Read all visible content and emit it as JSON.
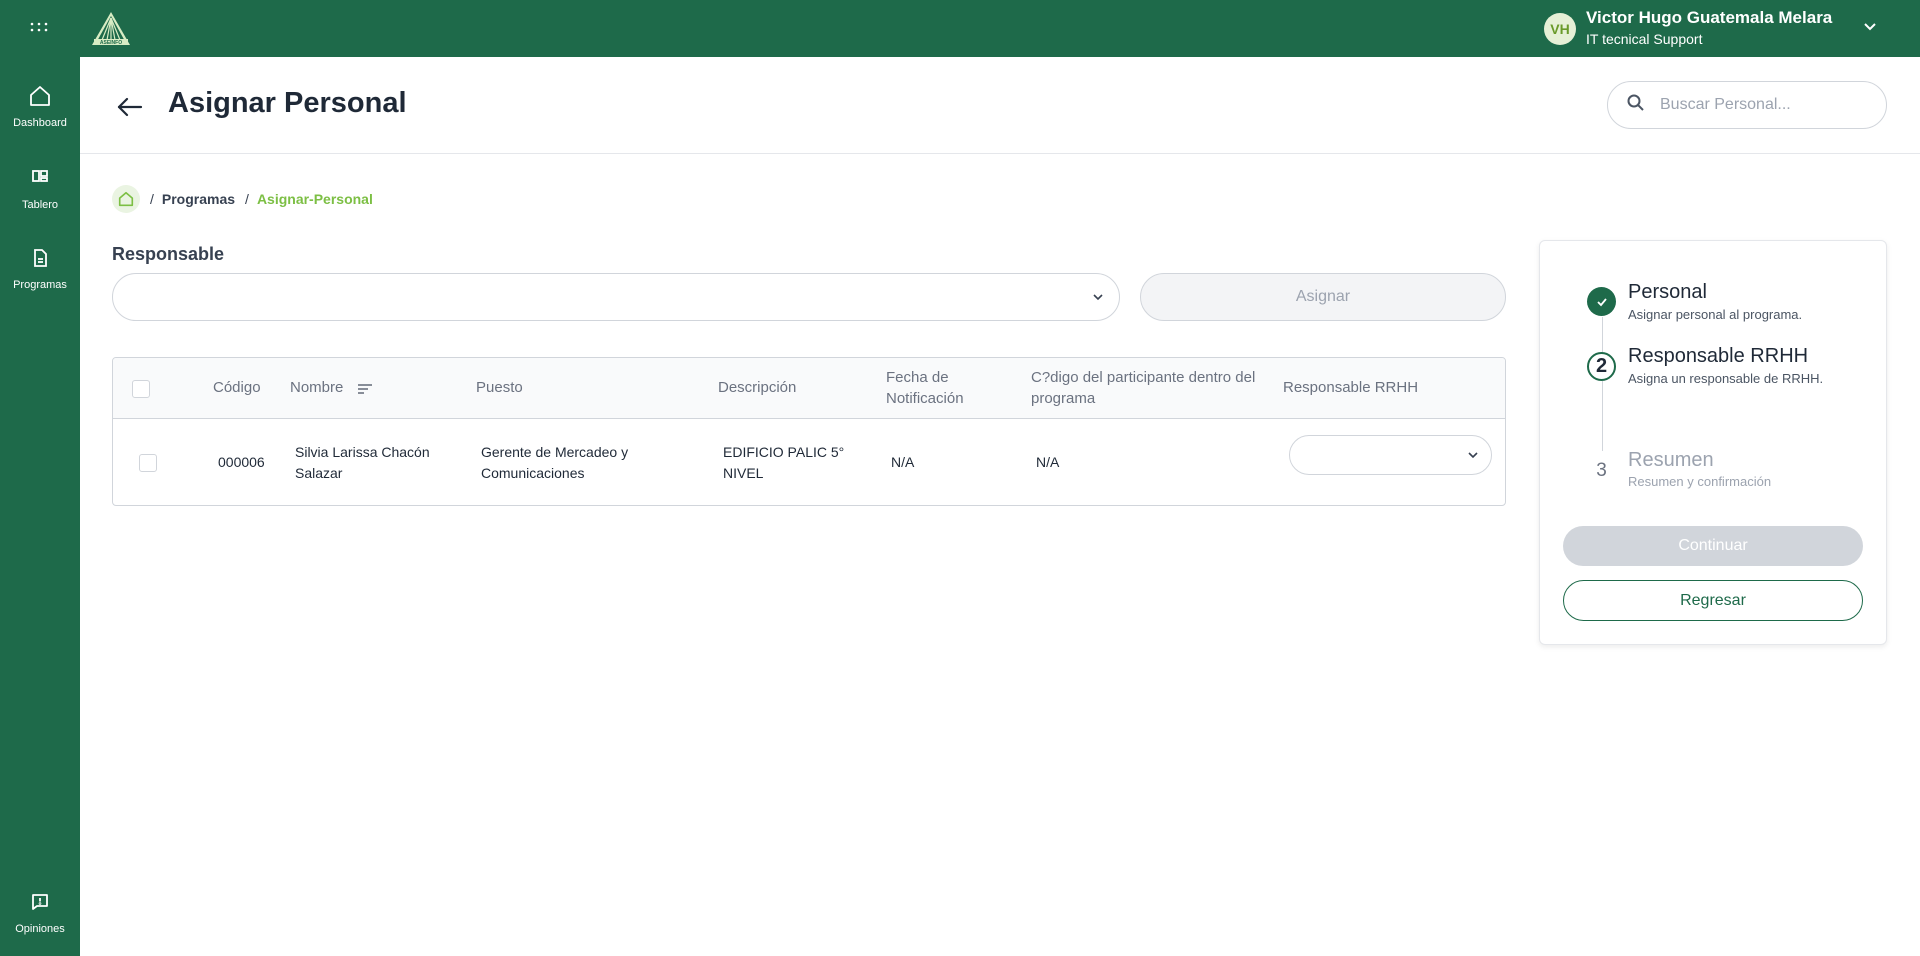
{
  "colors": {
    "brand_green": "#1e6a4a",
    "accent_green": "#7cbf44",
    "disabled_gray": "#d1d5db"
  },
  "topbar": {
    "apps_icon": "apps-grid-icon",
    "logo_text": "ASEINFO",
    "user": {
      "initials": "VH",
      "name": "Victor Hugo Guatemala Melara",
      "role": "IT tecnical Support"
    }
  },
  "sidebar": {
    "items": [
      {
        "label": "Dashboard",
        "icon": "home-icon"
      },
      {
        "label": "Tablero",
        "icon": "board-icon"
      },
      {
        "label": "Programas",
        "icon": "document-icon"
      }
    ],
    "footer": {
      "label": "Opiniones",
      "icon": "feedback-icon"
    }
  },
  "header": {
    "title": "Asignar Personal",
    "search_placeholder": "Buscar Personal..."
  },
  "breadcrumb": {
    "items": [
      "Programas"
    ],
    "current": "Asignar-Personal"
  },
  "form": {
    "responsable_label": "Responsable",
    "responsable_value": "",
    "assign_label": "Asignar"
  },
  "table": {
    "headers": {
      "codigo": "Código",
      "nombre": "Nombre",
      "puesto": "Puesto",
      "descripcion": "Descripción",
      "fecha": "Fecha de Notificación",
      "codigo_participante": "C?digo del participante dentro del programa",
      "responsable": "Responsable RRHH"
    },
    "rows": [
      {
        "codigo": "000006",
        "nombre": "Silvia Larissa Chacón Salazar",
        "puesto": "Gerente de Mercadeo y Comunicaciones",
        "descripcion": "EDIFICIO PALIC 5° NIVEL",
        "fecha": "N/A",
        "codigo_participante": "N/A",
        "responsable": ""
      }
    ]
  },
  "stepper": {
    "steps": [
      {
        "number": "1",
        "title": "Personal",
        "desc": "Asignar personal al programa.",
        "state": "done"
      },
      {
        "number": "2",
        "title": "Responsable RRHH",
        "desc": "Asigna un responsable de RRHH.",
        "state": "current"
      },
      {
        "number": "3",
        "title": "Resumen",
        "desc": "Resumen y confirmación",
        "state": "pending"
      }
    ],
    "continue_label": "Continuar",
    "back_label": "Regresar"
  }
}
